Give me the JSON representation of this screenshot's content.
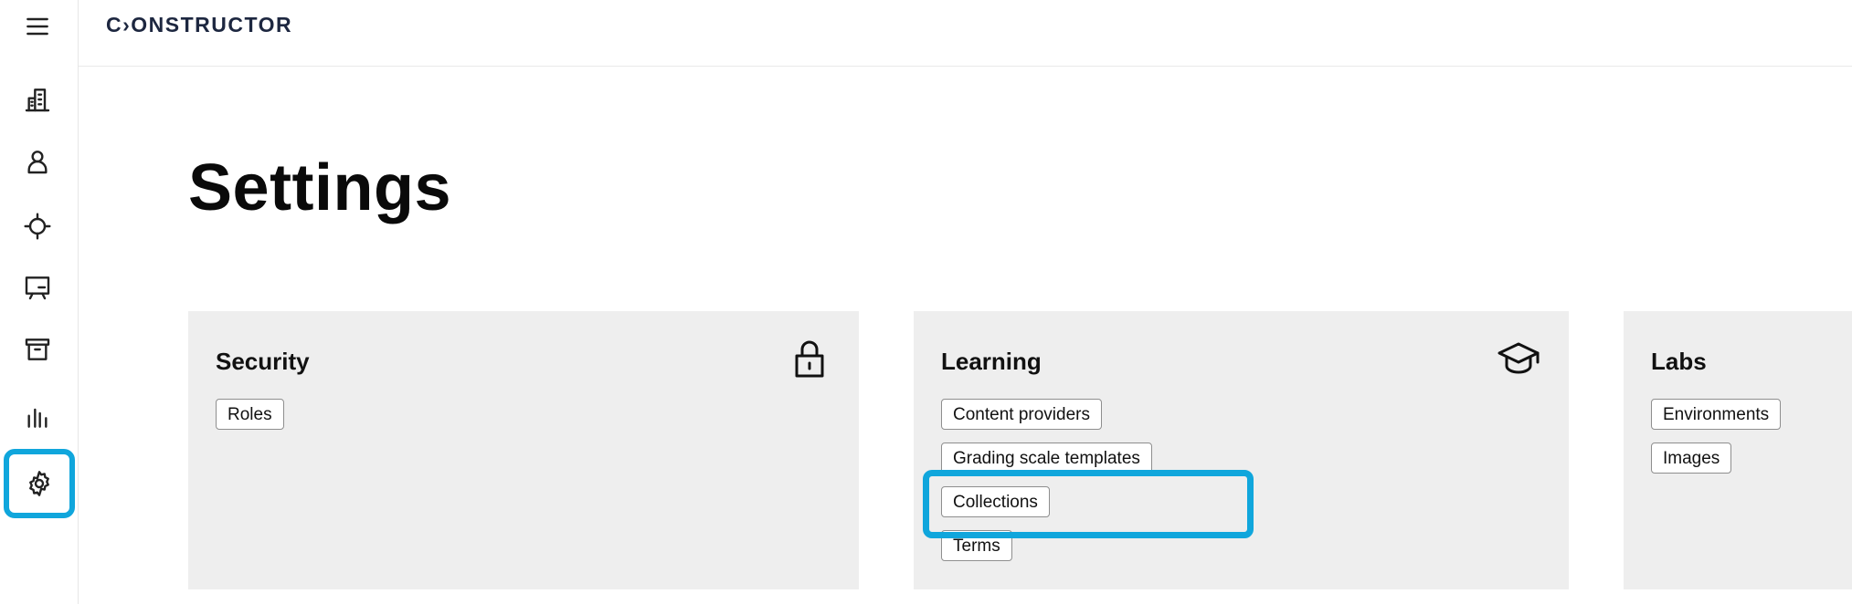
{
  "app": {
    "logo_text": "C›ONSTRUCTOR"
  },
  "sidebar": {
    "items": [
      {
        "name": "menu",
        "icon": "hamburger-menu-icon"
      },
      {
        "name": "organizations",
        "icon": "building-icon"
      },
      {
        "name": "users",
        "icon": "user-icon"
      },
      {
        "name": "targets",
        "icon": "crosshair-icon"
      },
      {
        "name": "presentations",
        "icon": "presentation-board-icon"
      },
      {
        "name": "archive",
        "icon": "archive-box-icon"
      },
      {
        "name": "analytics",
        "icon": "bar-chart-icon"
      },
      {
        "name": "settings",
        "icon": "gear-icon",
        "active": true
      }
    ],
    "accent_color": "#10a6dc"
  },
  "page": {
    "title": "Settings"
  },
  "cards": {
    "security": {
      "title": "Security",
      "icon": "lock-icon",
      "links": [
        "Roles"
      ]
    },
    "learning": {
      "title": "Learning",
      "icon": "graduation-cap-icon",
      "links": [
        "Content providers",
        "Grading scale templates",
        "Collections",
        "Terms"
      ]
    },
    "labs": {
      "title": "Labs",
      "links": [
        "Environments",
        "Images"
      ]
    }
  },
  "colors": {
    "card_bg": "#eeeeee",
    "highlight": "#10a6dc"
  }
}
